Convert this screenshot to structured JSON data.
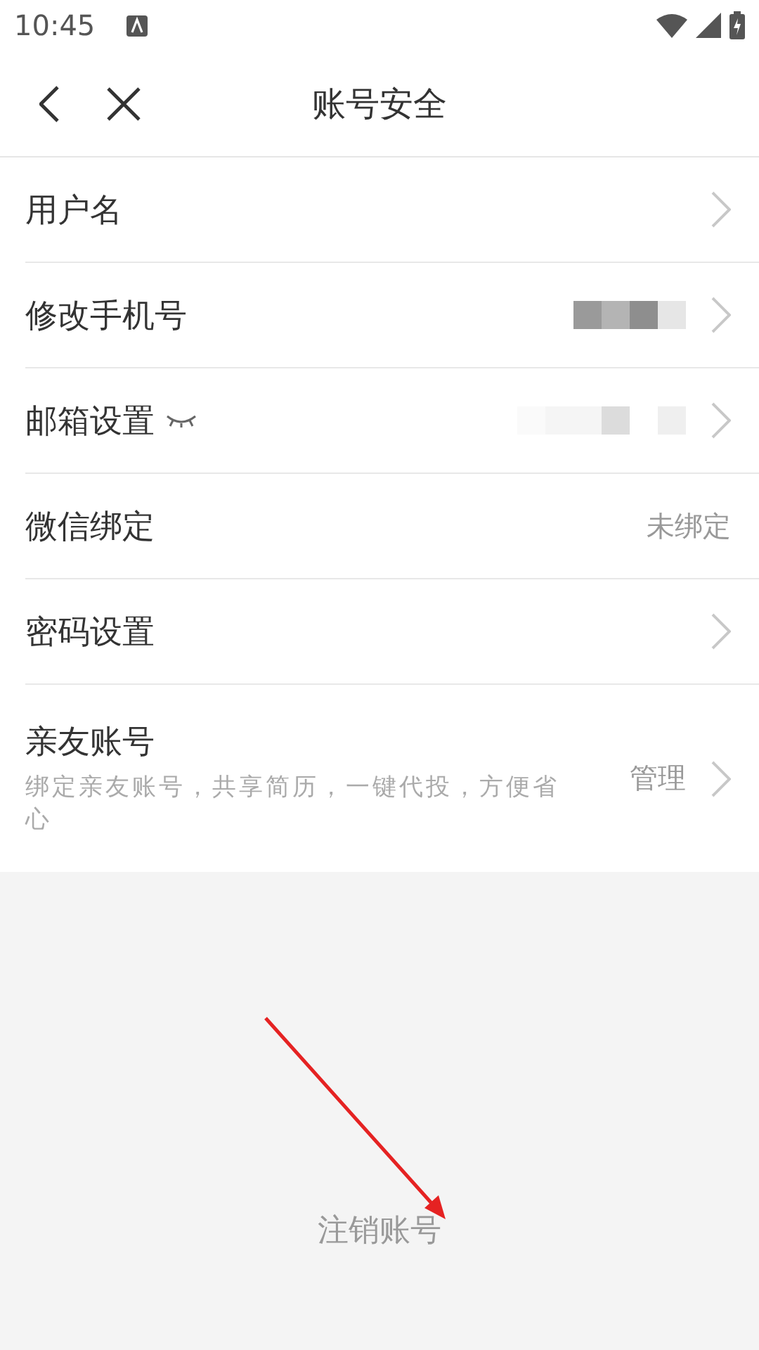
{
  "status_bar": {
    "time": "10:45"
  },
  "nav": {
    "title": "账号安全"
  },
  "rows": [
    {
      "label": "用户名",
      "chevron": true
    },
    {
      "label": "修改手机号",
      "value": {
        "kind": "masked"
      },
      "chevron": true
    },
    {
      "label": "邮箱设置",
      "eye_icon": true,
      "value": {
        "kind": "masked"
      },
      "chevron": true
    },
    {
      "label": "微信绑定",
      "value": {
        "kind": "text",
        "text": "未绑定"
      },
      "chevron": false
    },
    {
      "label": "密码设置",
      "chevron": true
    },
    {
      "label": "亲友账号",
      "subtitle": "绑定亲友账号，共享简历，一键代投，方便省心",
      "value": {
        "kind": "text",
        "text": "管理"
      },
      "chevron": true
    }
  ],
  "footer": {
    "link": "注销账号"
  },
  "annotation": {
    "kind": "arrow"
  }
}
